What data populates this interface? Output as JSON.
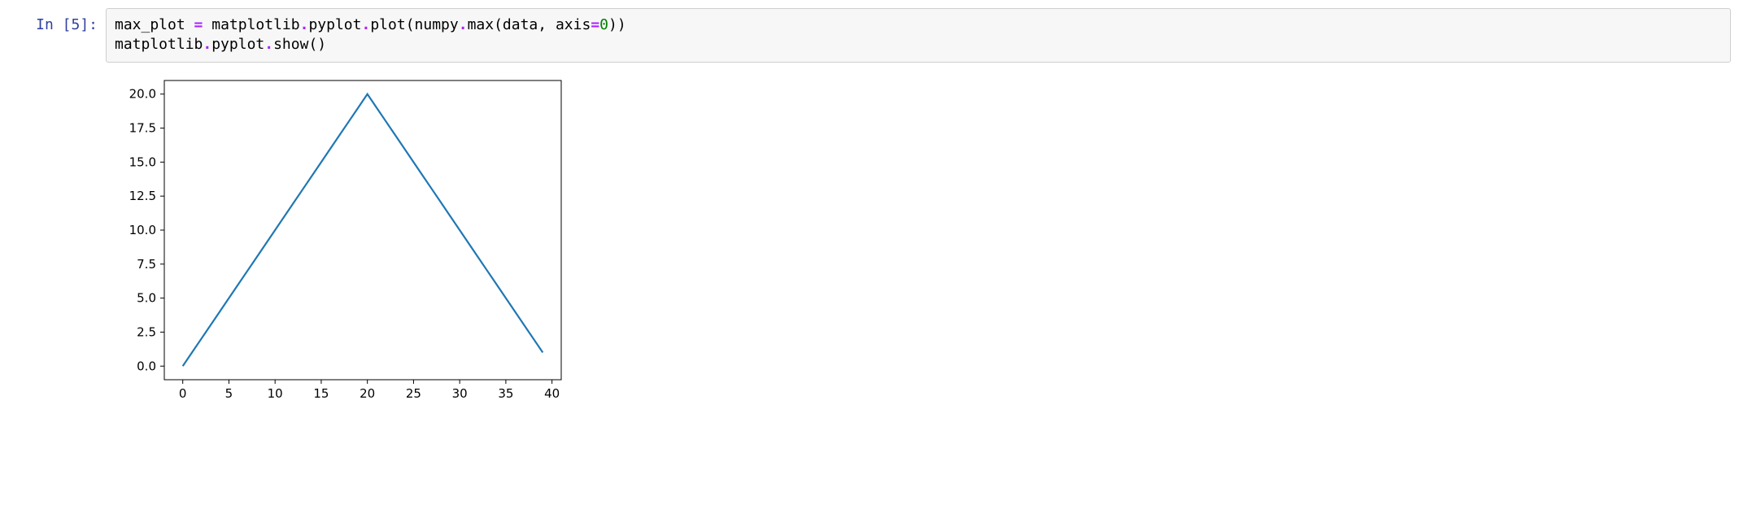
{
  "cell": {
    "prompt_label": "In [5]:",
    "code_line1_a": "max_plot ",
    "code_line1_eq": "=",
    "code_line1_b": " matplotlib",
    "code_line1_dot1": ".",
    "code_line1_c": "pyplot",
    "code_line1_dot2": ".",
    "code_line1_d": "plot",
    "code_line1_p1": "(",
    "code_line1_e": "numpy",
    "code_line1_dot3": ".",
    "code_line1_f": "max",
    "code_line1_p2": "(",
    "code_line1_g": "data",
    "code_line1_comma": ", ",
    "code_line1_h": "axis",
    "code_line1_eq2": "=",
    "code_line1_num": "0",
    "code_line1_p3": "))",
    "code_line2_a": "matplotlib",
    "code_line2_dot1": ".",
    "code_line2_b": "pyplot",
    "code_line2_dot2": ".",
    "code_line2_c": "show",
    "code_line2_p": "()"
  },
  "chart_data": {
    "type": "line",
    "x": [
      0,
      1,
      2,
      3,
      4,
      5,
      6,
      7,
      8,
      9,
      10,
      11,
      12,
      13,
      14,
      15,
      16,
      17,
      18,
      19,
      20,
      21,
      22,
      23,
      24,
      25,
      26,
      27,
      28,
      29,
      30,
      31,
      32,
      33,
      34,
      35,
      36,
      37,
      38,
      39
    ],
    "y": [
      0,
      1,
      2,
      3,
      4,
      5,
      6,
      7,
      8,
      9,
      10,
      11,
      12,
      13,
      14,
      15,
      16,
      17,
      18,
      19,
      20,
      19,
      18,
      17,
      16,
      15,
      14,
      13,
      12,
      11,
      10,
      9,
      8,
      7,
      6,
      5,
      4,
      3,
      2,
      1
    ],
    "title": "",
    "xlabel": "",
    "ylabel": "",
    "xlim": [
      -2,
      41
    ],
    "ylim": [
      -1,
      21
    ],
    "xticks": [
      0,
      5,
      10,
      15,
      20,
      25,
      30,
      35,
      40
    ],
    "yticks": [
      0.0,
      2.5,
      5.0,
      7.5,
      10.0,
      12.5,
      15.0,
      17.5,
      20.0
    ],
    "xtick_labels": [
      "0",
      "5",
      "10",
      "15",
      "20",
      "25",
      "30",
      "35",
      "40"
    ],
    "ytick_labels": [
      "0.0",
      "2.5",
      "5.0",
      "7.5",
      "10.0",
      "12.5",
      "15.0",
      "17.5",
      "20.0"
    ],
    "line_color": "#1f77b4"
  }
}
